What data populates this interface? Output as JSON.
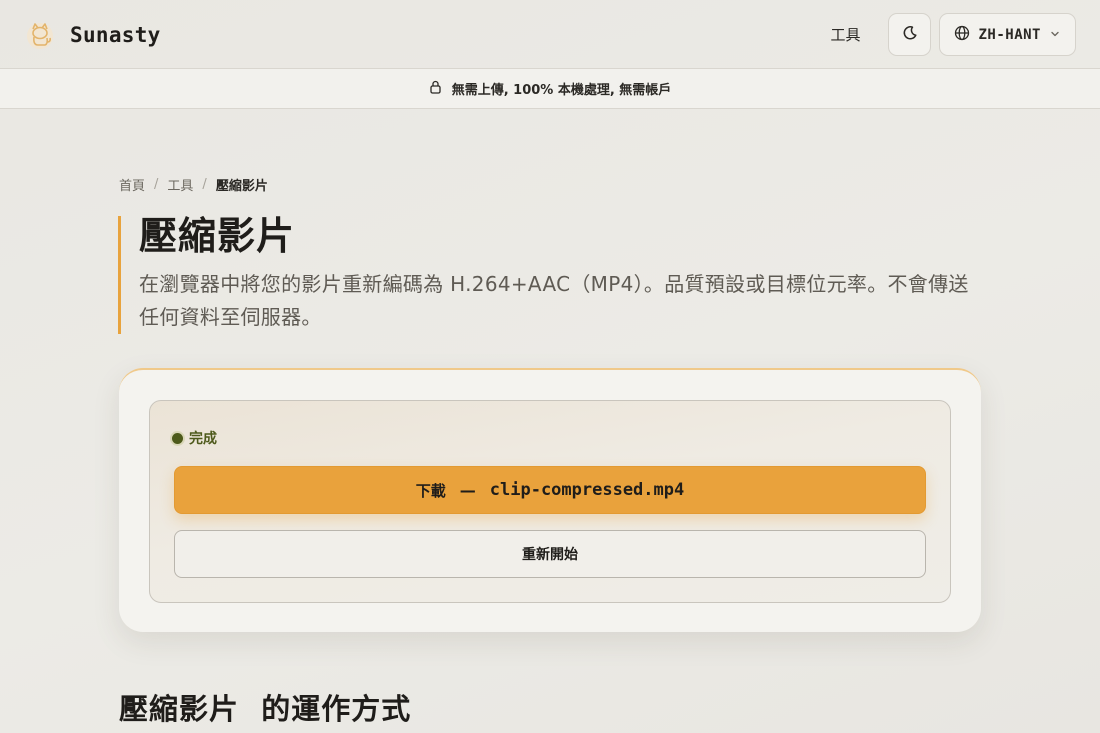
{
  "header": {
    "brand_name": "Sunasty",
    "logo_icon": "cat-icon",
    "nav_tools": "工具",
    "theme_icon": "moon-icon",
    "language": "ZH-HANT",
    "accent_color": "#e9a23c"
  },
  "privacy_bar": {
    "icon": "lock-icon",
    "text": "無需上傳, 100% 本機處理, 無需帳戶"
  },
  "breadcrumb": {
    "items": [
      "首頁",
      "工具",
      "壓縮影片"
    ],
    "separator": "/"
  },
  "page": {
    "title": "壓縮影片",
    "description": "在瀏覽器中將您的影片重新編碼為 H.264+AAC（MP4）。品質預設或目標位元率。不會傳送任何資料至伺服器。"
  },
  "card": {
    "status_text": "完成",
    "status_color": "#4d5a1a",
    "download_label": "下載",
    "download_dash": "—",
    "download_filename": "clip-compressed.mp4",
    "restart_label": "重新開始"
  },
  "section": {
    "heading": "壓縮影片  的運作方式"
  }
}
